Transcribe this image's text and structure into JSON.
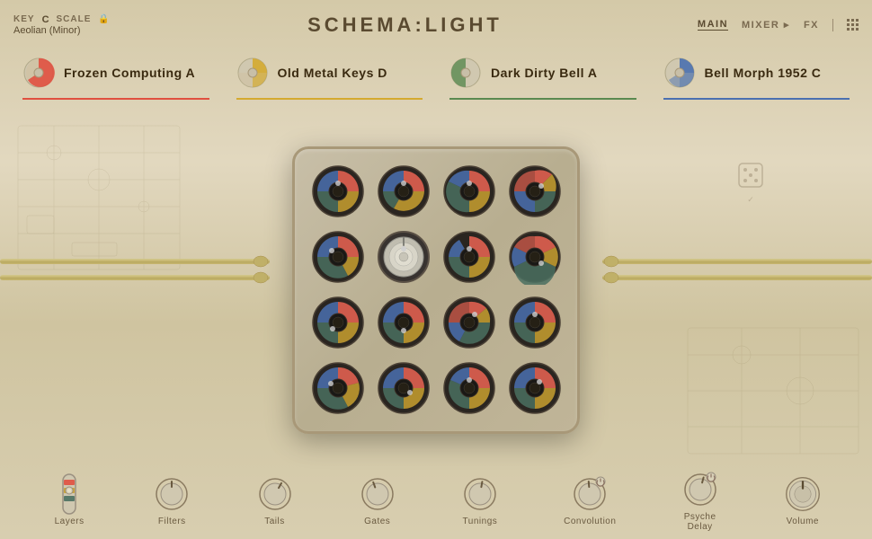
{
  "app": {
    "title_prefix": "SCHEMA:",
    "title_suffix": "LIGHT"
  },
  "header": {
    "key_label": "KEY",
    "key_value": "C",
    "scale_label": "SCALE",
    "scale_value": "Aeolian (Minor)",
    "lock_icon": "🔒"
  },
  "nav": {
    "main_label": "MAIN",
    "mixer_label": "MIXER ▸",
    "fx_label": "FX"
  },
  "instruments": [
    {
      "id": "frozen",
      "name": "Frozen Computing A",
      "note": "A",
      "color": "#e05040",
      "class": "inst-red",
      "pie_fill": 0.75
    },
    {
      "id": "oldmetal",
      "name": "Old Metal Keys D",
      "note": "D",
      "color": "#d4aa30",
      "class": "inst-yellow",
      "pie_fill": 0.6
    },
    {
      "id": "darkdirty",
      "name": "Dark Dirty Bell A",
      "note": "A",
      "color": "#5a8a50",
      "class": "inst-green",
      "pie_fill": 0.5
    },
    {
      "id": "bellmorph",
      "name": "Bell Morph 1952 C",
      "note": "C",
      "color": "#4a70b0",
      "class": "inst-blue",
      "pie_fill": 0.65
    }
  ],
  "knob_matrix": {
    "rows": 4,
    "cols": 4
  },
  "bottom_controls": [
    {
      "id": "layers",
      "label": "Layers",
      "type": "layers",
      "power": false
    },
    {
      "id": "filters",
      "label": "Filters",
      "type": "circle",
      "power": false
    },
    {
      "id": "tails",
      "label": "Tails",
      "type": "circle",
      "power": false
    },
    {
      "id": "gates",
      "label": "Gates",
      "type": "circle",
      "power": false
    },
    {
      "id": "tunings",
      "label": "Tunings",
      "type": "circle",
      "power": false
    },
    {
      "id": "convolution",
      "label": "Convolution",
      "type": "circle",
      "power": true
    },
    {
      "id": "psyche_delay",
      "label": "Psyche Delay",
      "type": "circle",
      "power": true
    },
    {
      "id": "volume",
      "label": "Volume",
      "type": "volume",
      "power": false
    }
  ]
}
